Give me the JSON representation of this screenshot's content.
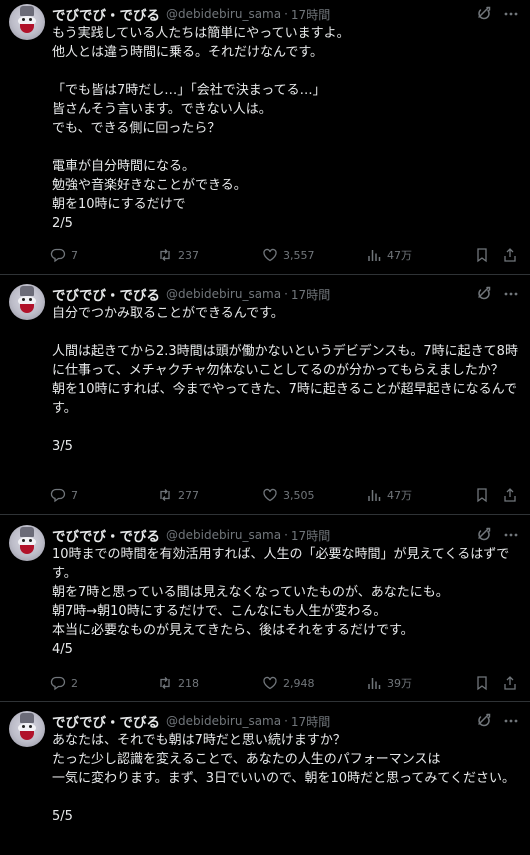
{
  "tweets": [
    {
      "name": "でびでび・でびる",
      "handle": "@debidebiru_sama",
      "time": "17時間",
      "text": "もう実践している人たちは簡単にやっていますよ。\n他人とは違う時間に乗る。それだけなんです。\n\n「でも皆は7時だし…」「会社で決まってる…」\n皆さんそう言います。できない人は。\nでも、できる側に回ったら？\n\n電車が自分時間になる。\n勉強や音楽好きなことができる。\n朝を10時にするだけで\n2/5",
      "replies": "7",
      "retweets": "237",
      "likes": "3,557",
      "views": "47万"
    },
    {
      "name": "でびでび・でびる",
      "handle": "@debidebiru_sama",
      "time": "17時間",
      "text": "自分でつかみ取ることができるんです。\n\n人間は起きてから2.3時間は頭が働かないというデビデンスも。7時に起きて8時に仕事って、メチャクチャ勿体ないことしてるのが分かってもらえましたか？\n朝を10時にすれば、今までやってきた、7時に起きることが超早起きになるんです。\n\n3/5",
      "replies": "7",
      "retweets": "277",
      "likes": "3,505",
      "views": "47万"
    },
    {
      "name": "でびでび・でびる",
      "handle": "@debidebiru_sama",
      "time": "17時間",
      "text": "10時までの時間を有効活用すれば、人生の「必要な時間」が見えてくるはずです。\n朝を7時と思っている間は見えなくなっていたものが、あなたにも。\n朝7時→朝10時にするだけで、こんなにも人生が変わる。\n本当に必要なものが見えてきたら、後はそれをするだけです。\n4/5",
      "replies": "2",
      "retweets": "218",
      "likes": "2,948",
      "views": "39万"
    },
    {
      "name": "でびでび・でびる",
      "handle": "@debidebiru_sama",
      "time": "17時間",
      "text": "あなたは、それでも朝は7時だと思い続けますか？\nたった少し認識を変えることで、あなたの人生のパフォーマンスは\n一気に変わります。まず、3日でいいので、朝を10時だと思ってみてください。\n\n5/5",
      "replies": "",
      "retweets": "",
      "likes": "",
      "views": ""
    }
  ],
  "separator": "·",
  "icons": {
    "grok": "grok-icon",
    "more": "more-dots-icon",
    "reply": "reply-icon",
    "retweet": "retweet-icon",
    "like": "heart-icon",
    "views": "views-chart-icon",
    "bookmark": "bookmark-icon",
    "share": "share-icon"
  },
  "colors": {
    "background": "#000000",
    "text": "#e7e9ea",
    "muted": "#71767b",
    "divider": "#2f3336"
  }
}
